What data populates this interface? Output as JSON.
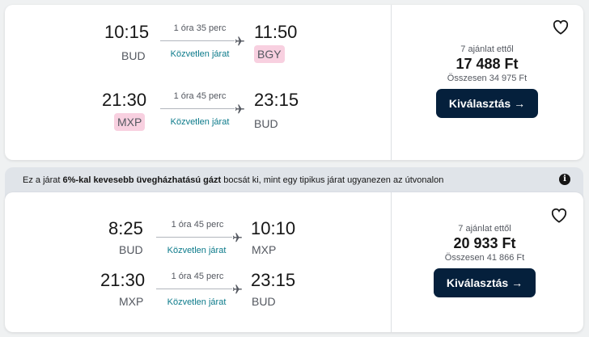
{
  "results": [
    {
      "legs": [
        {
          "depart_time": "10:15",
          "depart_airport": "BUD",
          "depart_hl": false,
          "duration": "1 óra 35 perc",
          "stops": "Közvetlen járat",
          "arrive_time": "11:50",
          "arrive_airport": "BGY",
          "arrive_hl": true
        },
        {
          "depart_time": "21:30",
          "depart_airport": "MXP",
          "depart_hl": true,
          "duration": "1 óra 45 perc",
          "stops": "Közvetlen járat",
          "arrive_time": "23:15",
          "arrive_airport": "BUD",
          "arrive_hl": false
        }
      ],
      "offers": "7 ajánlat ettől",
      "price": "17 488 Ft",
      "total": "Összesen 34 975 Ft",
      "select_label": "Kiválasztás →"
    },
    {
      "legs": [
        {
          "depart_time": "8:25",
          "depart_airport": "BUD",
          "depart_hl": false,
          "duration": "1 óra 45 perc",
          "stops": "Közvetlen járat",
          "arrive_time": "10:10",
          "arrive_airport": "MXP",
          "arrive_hl": false
        },
        {
          "depart_time": "21:30",
          "depart_airport": "MXP",
          "depart_hl": false,
          "duration": "1 óra 45 perc",
          "stops": "Közvetlen járat",
          "arrive_time": "23:15",
          "arrive_airport": "BUD",
          "arrive_hl": false
        }
      ],
      "offers": "7 ajánlat ettől",
      "price": "20 933 Ft",
      "total": "Összesen 41 866 Ft",
      "select_label": "Kiválasztás →"
    }
  ],
  "eco_banner": {
    "prefix": "Ez a járat ",
    "bold1": "6%-kal kevesebb üvegházhatású gázt",
    "suffix": " bocsát ki, mint egy tipikus járat ugyanezen az útvonalon",
    "info_icon": "info-icon"
  },
  "colors": {
    "button_bg": "#05203c",
    "highlight_airport": "#f8d0e0",
    "direct_text": "#0b7a8a"
  },
  "icons": {
    "plane": "plane-icon",
    "heart": "heart-icon",
    "arrow": "arrow-right-icon"
  }
}
